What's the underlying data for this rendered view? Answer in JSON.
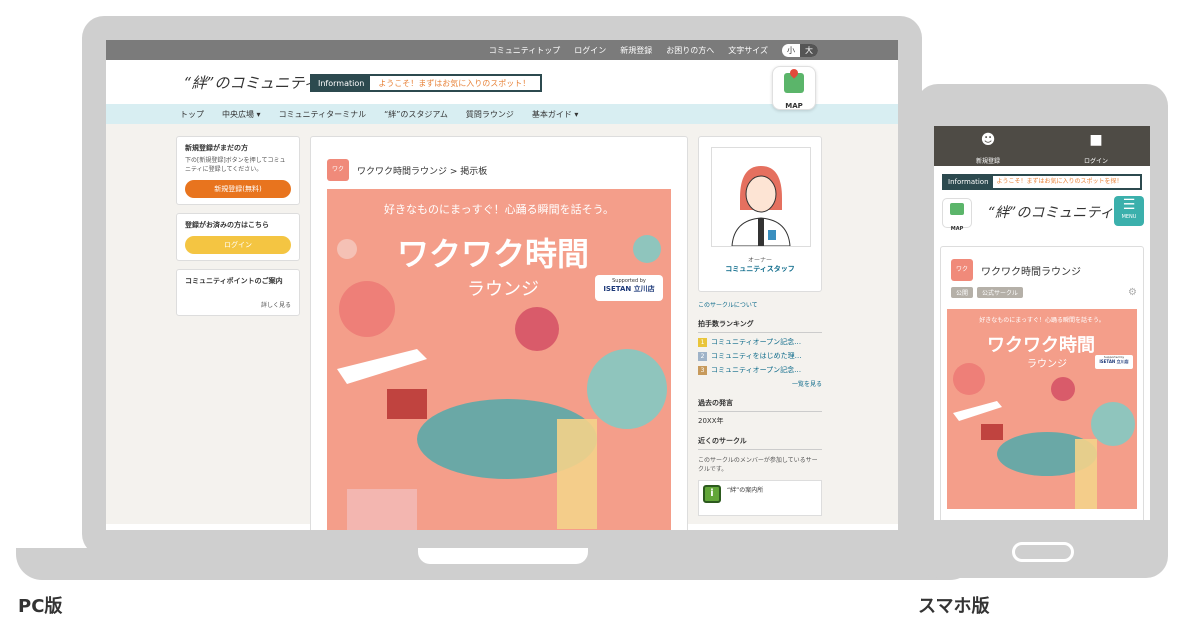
{
  "labels": {
    "pc": "PC版",
    "sp": "スマホ版"
  },
  "pc": {
    "topbar": {
      "links": [
        "コミュニティトップ",
        "ログイン",
        "新規登録",
        "お困りの方へ"
      ],
      "font_size_label": "文字サイズ",
      "size_small": "小",
      "size_large": "大"
    },
    "header": {
      "logo": "“絆”のコミュニティ",
      "info_label": "Information",
      "info_message": "ようこそ！まずはお気に入りのスポット！",
      "map_label": "MAP"
    },
    "nav": [
      "トップ",
      "中央広場 ▾",
      "コミュニティターミナル",
      "“絆”のスタジアム",
      "質問ラウンジ",
      "基本ガイド ▾"
    ],
    "left": {
      "register_title": "新規登録がまだの方",
      "register_text": "下の[新規登録]ボタンを押してコミュニティに登録してください。",
      "register_button": "新規登録(無料)",
      "login_title": "登録がお済みの方はこちら",
      "login_button": "ログイン",
      "points_title": "コミュニティポイントのご案内",
      "points_more": "詳しく見る"
    },
    "center": {
      "breadcrumb": "ワクワク時間ラウンジ > 掲示板",
      "icon_text": "ワク"
    },
    "right": {
      "owner_label": "オーナー",
      "owner_name": "コミュニティスタッフ",
      "about_link": "このサークルについて",
      "ranking_title": "拍手数ランキング",
      "ranking": [
        {
          "rank": "1",
          "text": "コミュニティオープン記念…",
          "color": "#e9c53a"
        },
        {
          "rank": "2",
          "text": "コミュニティをはじめた理…",
          "color": "#9fb3c8"
        },
        {
          "rank": "3",
          "text": "コミュニティオープン記念…",
          "color": "#c79a5c"
        }
      ],
      "ranking_more": "一覧を見る",
      "past_title": "過去の発言",
      "past_year": "20XX年",
      "near_title": "近くのサークル",
      "near_text": "このサークルのメンバーが参加しているサークルです。",
      "guide_text": "“絆”の案内所",
      "guide_icon": "i"
    }
  },
  "banner": {
    "tagline": "好きなものにまっすぐ！心踊る瞬間を話そう。",
    "title": "ワクワク時間",
    "subtitle": "ラウンジ",
    "supported_by": "Supported by",
    "sponsor": "ISETAN 立川店"
  },
  "sp": {
    "topbar": {
      "register": "新規登録",
      "login": "ログイン"
    },
    "info_label": "Information",
    "info_message": "ようこそ！まずはお気に入りのスポットを探！",
    "map_label": "MAP",
    "logo": "“絆”のコミュニティ",
    "menu_label": "MENU",
    "card_title": "ワクワク時間ラウンジ",
    "tags": [
      "公開",
      "公式サークル"
    ],
    "icon_text": "ワク"
  },
  "colors": {
    "accent_teal": "#3bb0ac",
    "brand_dark": "#2c4a4f",
    "orange": "#e8741e",
    "banner_pink": "#f49e8a"
  }
}
